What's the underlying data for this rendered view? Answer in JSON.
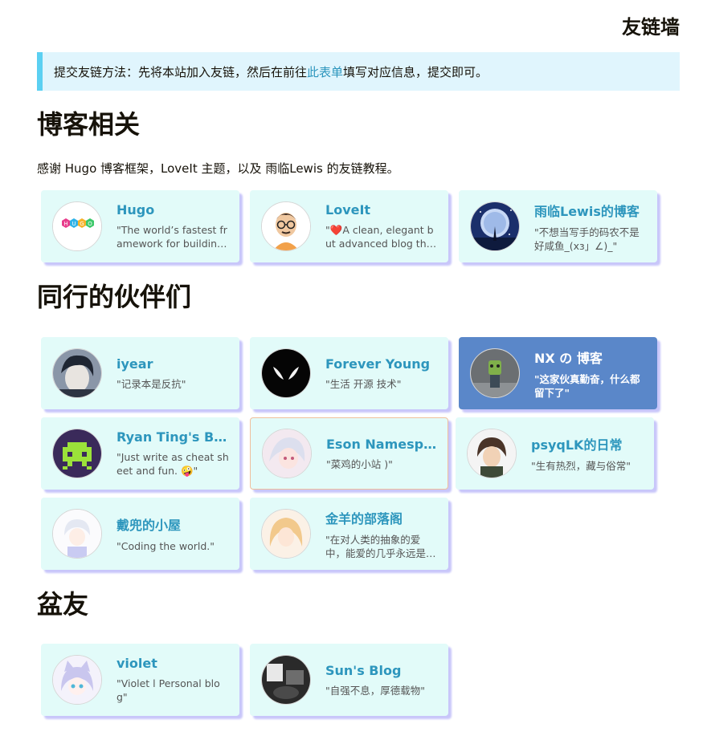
{
  "page": {
    "title": "友链墙"
  },
  "notice": {
    "prefix": "提交友链方法：先将本站加入友链，然后在前往",
    "link": "此表单",
    "suffix": "填写对应信息，提交即可。"
  },
  "sections": [
    {
      "title": "博客相关",
      "intro": "感谢 Hugo 博客框架，LoveIt 主题，以及 雨临Lewis 的友链教程。"
    },
    {
      "title": "同行的伙伴们"
    },
    {
      "title": "盆友"
    }
  ],
  "blog": [
    {
      "name": "Hugo",
      "desc": "\"The world’s fastest framework for building websites\"",
      "icon": "hugo-logo-icon"
    },
    {
      "name": "LoveIt",
      "desc": "\"❤️A clean, elegant but advanced blog theme for Hugo\"",
      "icon": "glasses-avatar-icon"
    },
    {
      "name": "雨临Lewis的博客",
      "desc": "\"不想当写手的码农不是好咸鱼_(xз」∠)_\"",
      "icon": "moon-avatar-icon"
    }
  ],
  "peers": [
    {
      "name": "iyear",
      "desc": "\"记录本是反抗\"",
      "icon": "anime-boy-avatar-icon"
    },
    {
      "name": "Forever Young",
      "desc": "\"生活 开源 技术\"",
      "icon": "venom-avatar-icon"
    },
    {
      "name": "NX の 博客",
      "desc": "\"这家伙真勤奋，什么都留下了\"",
      "icon": "robot-avatar-icon"
    },
    {
      "name": "Ryan Ting's Blog",
      "desc": "\"Just write as cheat sheet and fun. 🤪\"",
      "icon": "space-invader-avatar-icon"
    },
    {
      "name": "Eson Namespace",
      "desc": "\"菜鸡的小站 )\"",
      "icon": "anime-girl-avatar-icon"
    },
    {
      "name": "psyqLK的日常",
      "desc": "\"生有热烈，藏与俗常\"",
      "icon": "anime-character-avatar-icon"
    },
    {
      "name": "戴兜的小屋",
      "desc": "\"Coding the world.\"",
      "icon": "white-hair-avatar-icon"
    },
    {
      "name": "金羊的部落阁",
      "desc": "\"在对人类的抽象的爱中，能爱的几乎永远是自己\"",
      "icon": "blonde-girl-avatar-icon"
    }
  ],
  "friends": [
    {
      "name": "violet",
      "desc": "\"Violet l Personal blog\"",
      "icon": "cat-girl-avatar-icon"
    },
    {
      "name": "Sun's Blog",
      "desc": "\"自强不息，厚德载物\"",
      "icon": "photo-avatar-icon"
    }
  ],
  "colors": {
    "accent": "#2d96bd",
    "card_bg": "#e2fbf9",
    "highlight_card": "#5a87c9",
    "notice_border": "#5bd0f2"
  }
}
